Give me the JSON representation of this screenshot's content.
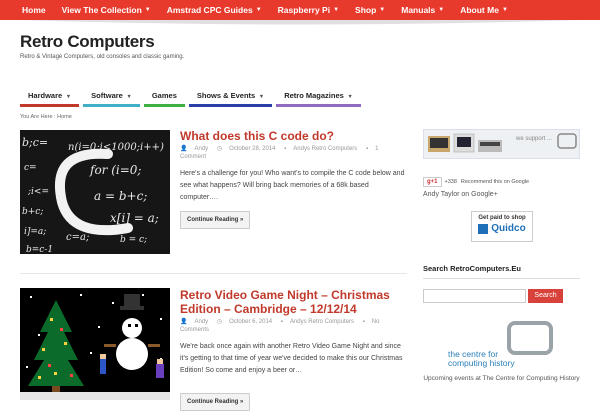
{
  "topnav": [
    {
      "label": "Home",
      "has_menu": false
    },
    {
      "label": "View The Collection",
      "has_menu": true
    },
    {
      "label": "Amstrad CPC Guides",
      "has_menu": true
    },
    {
      "label": "Raspberry Pi",
      "has_menu": true
    },
    {
      "label": "Shop",
      "has_menu": true
    },
    {
      "label": "Manuals",
      "has_menu": true
    },
    {
      "label": "About Me",
      "has_menu": true
    }
  ],
  "site": {
    "title": "Retro Computers",
    "tagline": "Retro & Vintage Computers, old consoles and classic gaming."
  },
  "mainnav": [
    {
      "label": "Hardware",
      "has_menu": true,
      "color": "#c0392b"
    },
    {
      "label": "Software",
      "has_menu": true,
      "color": "#3fb0c8"
    },
    {
      "label": "Games",
      "has_menu": false,
      "color": "#3cb043"
    },
    {
      "label": "Shows & Events",
      "has_menu": true,
      "color": "#2a3fa8"
    },
    {
      "label": "Retro Magazines",
      "has_menu": true,
      "color": "#8e6bc0"
    }
  ],
  "breadcrumb": {
    "prefix": "You Are Here :",
    "current": "Home"
  },
  "posts": [
    {
      "title": "What does this C code do?",
      "author": "Andy",
      "date": "October 28, 2014",
      "category": "Andys Retro Computers",
      "comments": "1 Comment",
      "excerpt": "Here's a challenge for you! Who want's to compile the C code below and see what happens? Will bring back memories of a 68k based computer….",
      "read_more": "Continue Reading »",
      "image": "c-code-chalkboard"
    },
    {
      "title": "Retro Video Game Night – Christmas Edition – Cambridge – 12/12/14",
      "author": "Andy",
      "date": "October 6, 2014",
      "category": "Andys Retro Computers",
      "comments": "No Comments",
      "excerpt": "We're back once again with another Retro Video Game Night and since it's getting to that time of year we've decided to make this our Christmas Edition! So come and enjoy a beer or…",
      "read_more": "Continue Reading »",
      "image": "pixel-christmas-scene"
    }
  ],
  "sidebar": {
    "banner_text": "we support ...",
    "gplus": {
      "button": "g+1",
      "count": "+338",
      "text": "Recommend this on Google",
      "name": "Andy Taylor on Google+"
    },
    "quidco": {
      "line1": "Get paid to shop",
      "brand": "Quidco"
    },
    "search": {
      "title": "Search RetroComputers.Eu",
      "placeholder": "",
      "button": "Search"
    },
    "cch": {
      "logo_line1": "the centre for",
      "logo_line2": "computing history",
      "caption": "Upcoming events at The Centre for Computing History"
    }
  },
  "colors": {
    "accent": "#e83a2c",
    "title_red": "#c0392b",
    "link_blue": "#2a7fb8"
  }
}
